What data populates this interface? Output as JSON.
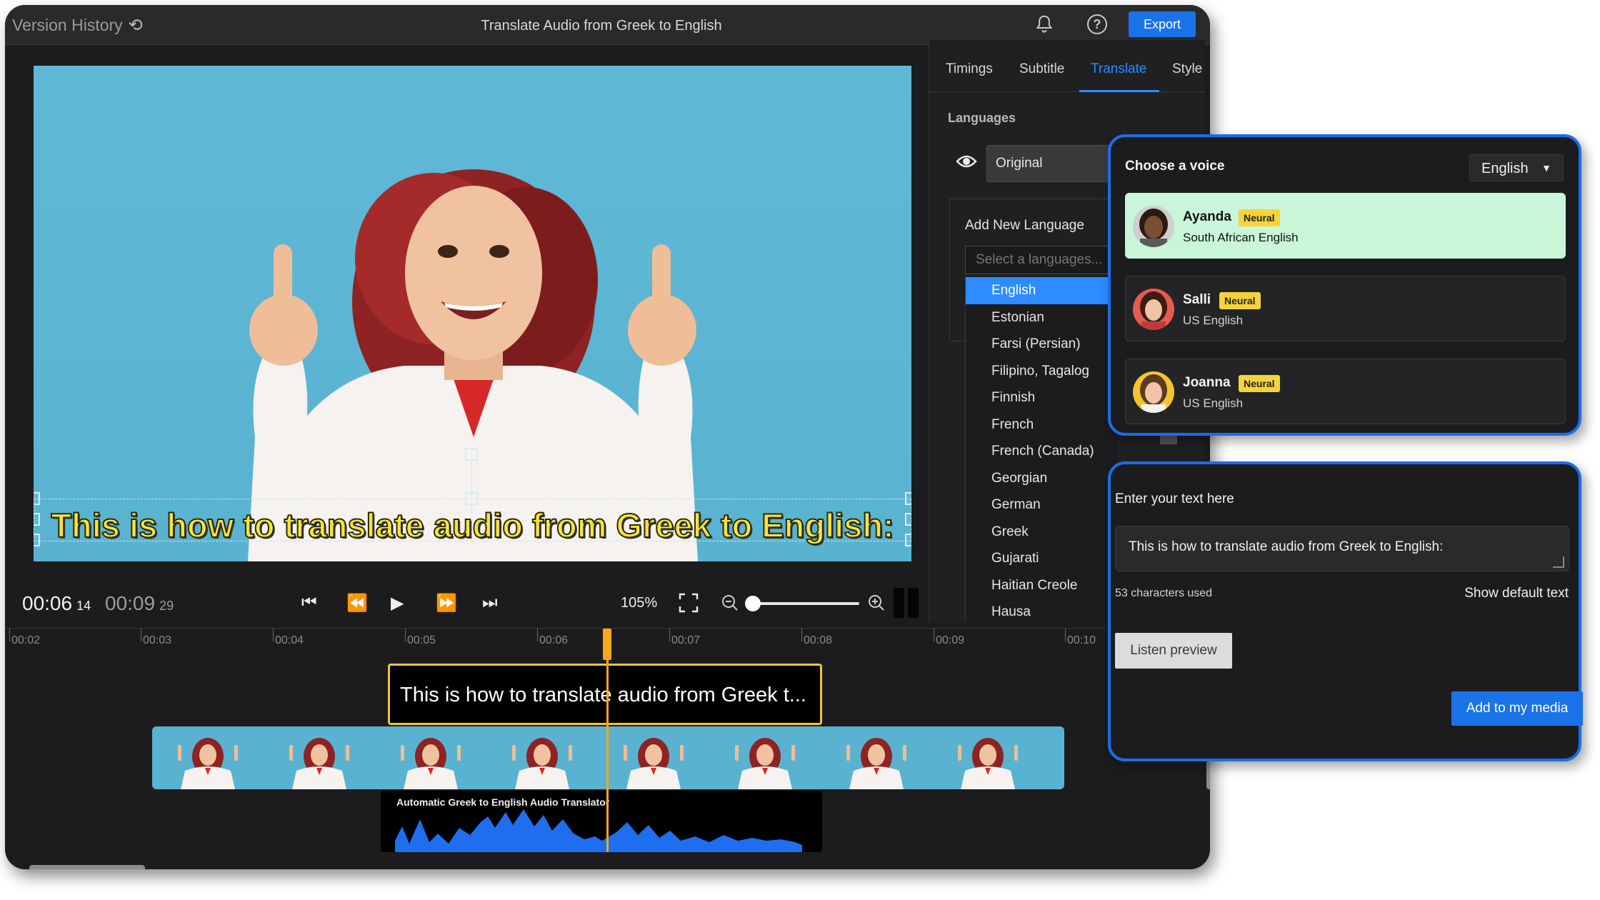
{
  "header": {
    "version_history": "Version History",
    "title": "Translate Audio from Greek to English",
    "export_label": "Export"
  },
  "video": {
    "subtitle": "This is how to translate audio from Greek to English:"
  },
  "controls": {
    "current_time": "00:06",
    "current_frame": "14",
    "total_time": "00:09",
    "total_frame": "29",
    "zoom": "105%",
    "zoom_slider_level": 0.05
  },
  "timeline": {
    "ticks": [
      "00:02",
      "00:03",
      "00:04",
      "00:05",
      "00:06",
      "00:07",
      "00:08",
      "00:09",
      "00:10"
    ],
    "subtitle_clip": "This is how to translate audio from Greek t...",
    "audio_clip": "Automatic Greek to English Audio Translator"
  },
  "tabs": [
    "Timings",
    "Subtitle",
    "Translate",
    "Style"
  ],
  "active_tab": "Translate",
  "languages": {
    "heading": "Languages",
    "original": "Original",
    "add_heading": "Add New Language",
    "select_placeholder": "Select a languages...",
    "options": [
      "English",
      "Estonian",
      "Farsi (Persian)",
      "Filipino, Tagalog",
      "Finnish",
      "French",
      "French (Canada)",
      "Georgian",
      "German",
      "Greek",
      "Gujarati",
      "Haitian Creole",
      "Hausa"
    ],
    "selected": "English"
  },
  "voice_panel": {
    "title": "Choose a voice",
    "language": "English",
    "voices": [
      {
        "name": "Ayanda",
        "badge": "Neural",
        "accent": "South African English",
        "selected": true
      },
      {
        "name": "Salli",
        "badge": "Neural",
        "accent": "US English",
        "selected": false
      },
      {
        "name": "Joanna",
        "badge": "Neural",
        "accent": "US English",
        "selected": false
      }
    ]
  },
  "text_panel": {
    "heading": "Enter your text here",
    "text": "This is how to translate audio from Greek to English:",
    "count": "53 characters used",
    "show_default": "Show default text",
    "listen": "Listen preview",
    "add": "Add to my media"
  },
  "colors": {
    "accent": "#1a73e8",
    "playhead": "#f4a81c",
    "subtitle_yellow": "#f7e43a",
    "selected_voice_bg": "#c9f5d8",
    "badge": "#f7d33a"
  }
}
